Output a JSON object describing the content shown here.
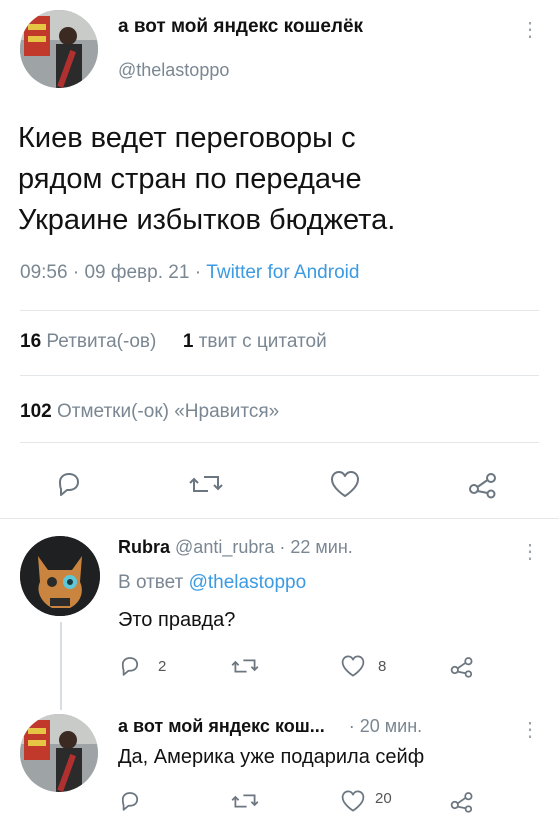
{
  "main_tweet": {
    "display_name": "а вот мой яндекс кошелёк",
    "handle": "@thelastoppo",
    "text_lines": [
      "Киев ведет переговоры с",
      "рядом стран по передаче",
      "Украине избытков бюджета."
    ],
    "time": "09:56",
    "date": "09 февр. 21",
    "source": "Twitter for Android",
    "retweets_count": "16",
    "retweets_label": "Ретвита(-ов)",
    "quotes_count": "1",
    "quotes_label": "твит с цитатой",
    "likes_count": "102",
    "likes_label": "Отметки(-ок) «Нравится»"
  },
  "reply1": {
    "display_name": "Rubra",
    "handle": "@anti_rubra",
    "time_ago": "22 мин.",
    "reply_to_prefix": "В ответ",
    "reply_to_handle": "@thelastoppo",
    "text": "Это правда?",
    "reply_count": "2",
    "like_count": "8"
  },
  "reply2": {
    "display_name": "а вот мой яндекс кош...",
    "time_ago": "20 мин.",
    "text": "Да, Америка уже подарила сейф",
    "like_count": "20"
  },
  "colors": {
    "link": "#3b9ae1",
    "muted": "#7a8792",
    "divider": "#e3e7ea"
  },
  "icons": [
    "reply-icon",
    "retweet-icon",
    "like-icon",
    "share-icon",
    "more-icon"
  ]
}
